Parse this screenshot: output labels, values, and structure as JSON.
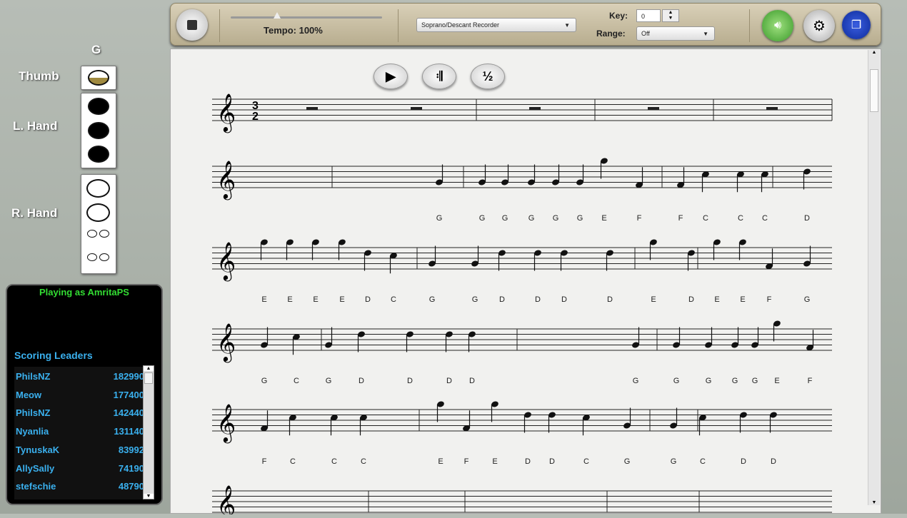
{
  "toolbar": {
    "tempo_label": "Tempo: 100%",
    "tempo_value": 100,
    "instrument": "Soprano/Descant Recorder",
    "key_label": "Key:",
    "key_value": "0",
    "range_label": "Range:",
    "range_value": "Off"
  },
  "fingering": {
    "note": "G",
    "thumb_label": "Thumb",
    "left_label": "L. Hand",
    "right_label": "R. Hand"
  },
  "player": {
    "playing_as": "Playing as AmritaPS"
  },
  "leaders": {
    "title": "Scoring Leaders",
    "rows": [
      {
        "name": "PhilsNZ",
        "score": "182990"
      },
      {
        "name": "Meow",
        "score": "177400"
      },
      {
        "name": "PhilsNZ",
        "score": "142440"
      },
      {
        "name": "Nyanlia",
        "score": "131140"
      },
      {
        "name": "TynuskaK",
        "score": "83992"
      },
      {
        "name": "AllySally",
        "score": "74190"
      },
      {
        "name": "stefschie",
        "score": "48790"
      }
    ]
  },
  "score": {
    "time_signature": [
      "3",
      "2"
    ],
    "transport": {
      "half_label": "½"
    },
    "note_labels": [
      [],
      [
        "G",
        "G",
        "G",
        "G",
        "G",
        "G",
        "E",
        "F",
        "F",
        "C",
        "C",
        "C",
        "D"
      ],
      [
        "E",
        "E",
        "E",
        "E",
        "D",
        "C",
        "G",
        "G",
        "D",
        "D",
        "D",
        "D",
        "E",
        "D",
        "E",
        "E",
        "F",
        "G"
      ],
      [
        "G",
        "C",
        "G",
        "D",
        "D",
        "D",
        "D",
        "G",
        "G",
        "G",
        "G",
        "G",
        "E",
        "F"
      ],
      [
        "F",
        "C",
        "C",
        "C",
        "E",
        "F",
        "E",
        "D",
        "D",
        "C",
        "G",
        "G",
        "C",
        "D",
        "D"
      ]
    ]
  }
}
